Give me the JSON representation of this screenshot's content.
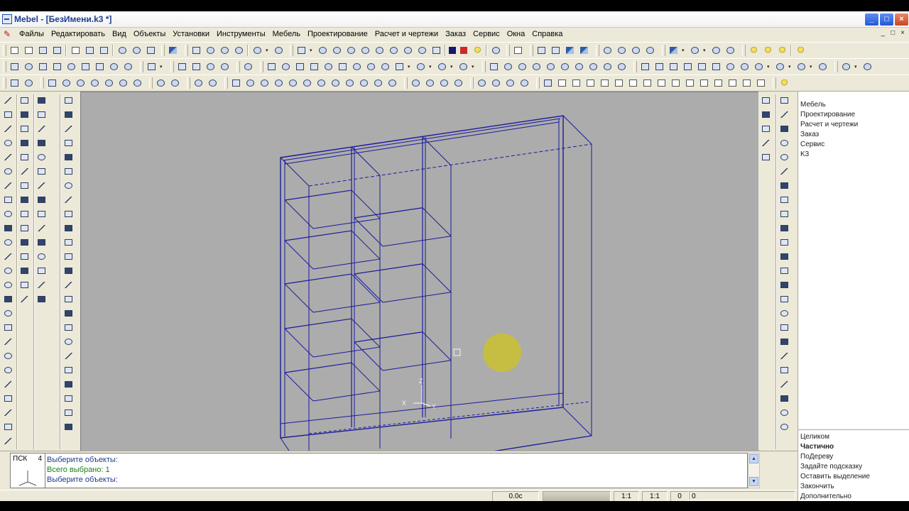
{
  "window": {
    "title": "Mebel - [БезИмени.k3 *]",
    "min_glyph": "_",
    "max_glyph": "□",
    "close_glyph": "×"
  },
  "menu": {
    "items": [
      "Файлы",
      "Редактировать",
      "Вид",
      "Объекты",
      "Установки",
      "Инструменты",
      "Мебель",
      "Проектирование",
      "Расчет и чертежи",
      "Заказ",
      "Сервис",
      "Окна",
      "Справка"
    ],
    "mdi_controls": [
      "_",
      "□",
      "×"
    ]
  },
  "right_panel": {
    "top_items": [
      "Мебель",
      "Проектирование",
      "Расчет и чертежи",
      "Заказ",
      "Сервис",
      "K3"
    ],
    "bottom_items": [
      {
        "label": "Целиком",
        "bold": false
      },
      {
        "label": "Частично",
        "bold": true
      },
      {
        "label": "ПоДереву",
        "bold": false
      },
      {
        "label": "Задайте подсказку",
        "bold": false
      },
      {
        "label": "Оставить выделение",
        "bold": false
      },
      {
        "label": "Закончить",
        "bold": false
      },
      {
        "label": "Дополнительно",
        "bold": false
      }
    ]
  },
  "command": {
    "ucs_label": "ПСК",
    "ucs_number": "4",
    "lines": [
      "Выберите объекты:",
      "Всего выбрано: 1",
      "Выберите объекты:"
    ]
  },
  "status": {
    "time": "0.0с",
    "scale1": "1:1",
    "scale2": "1:1",
    "field1": "0",
    "field2": "0"
  },
  "viewport": {
    "axis_z": "Z",
    "axis_x": "X",
    "axis_y": "Y",
    "background": "#acacac",
    "wire_color": "#1a1a9e",
    "cursor_color": "#c9c036"
  }
}
